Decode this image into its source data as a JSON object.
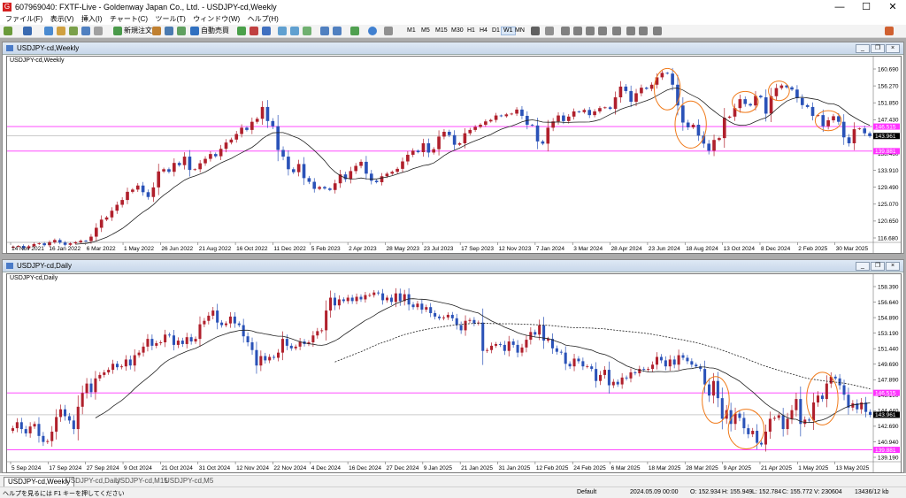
{
  "window": {
    "title": "607969040: FXTF-Live - Goldenway Japan Co., Ltd. - USDJPY-cd,Weekly",
    "minimize": "—",
    "maximize": "☐",
    "close": "✕"
  },
  "menu": [
    "ファイル(F)",
    "表示(V)",
    "挿入(I)",
    "チャート(C)",
    "ツール(T)",
    "ウィンドウ(W)",
    "ヘルプ(H)"
  ],
  "toolbar": {
    "new_order": "新規注文",
    "auto_trading": "自動売買",
    "timeframes": [
      "M1",
      "M5",
      "M15",
      "M30",
      "H1",
      "H4",
      "D1",
      "W1",
      "MN"
    ],
    "active_timeframe": "W1"
  },
  "weekly": {
    "caption": "USDJPY-cd,Weekly",
    "symbol_label": "USDJPY-cd,Weekly",
    "price_labels": [
      "160.690",
      "156.270",
      "151.850",
      "147.430",
      "143.010",
      "138.460",
      "133.910",
      "129.490",
      "125.070",
      "120.650",
      "116.680"
    ],
    "current_price": "143.961",
    "line_high_label": "146.515",
    "line_low_label": "139.881",
    "date_labels": [
      "14 Nov 2021",
      "16 Jan 2022",
      "6 Mar 2022",
      "1 May 2022",
      "26 Jun 2022",
      "21 Aug 2022",
      "16 Oct 2022",
      "11 Dec 2022",
      "5 Feb 2023",
      "2 Apr 2023",
      "28 May 2023",
      "23 Jul 2023",
      "17 Sep 2023",
      "12 Nov 2023",
      "7 Jan 2024",
      "3 Mar 2024",
      "28 Apr 2024",
      "23 Jun 2024",
      "18 Aug 2024",
      "13 Oct 2024",
      "8 Dec 2024",
      "2 Feb 2025",
      "30 Mar 2025"
    ]
  },
  "daily": {
    "caption": "USDJPY-cd,Daily",
    "symbol_label": "USDJPY-cd,Daily",
    "price_labels": [
      "158.390",
      "156.640",
      "154.890",
      "153.190",
      "151.440",
      "149.690",
      "147.890",
      "146.190",
      "144.440",
      "142.690",
      "140.940",
      "139.190"
    ],
    "current_price": "143.961",
    "line_high_label": "146.515",
    "line_low_label": "139.881",
    "date_labels": [
      "5 Sep 2024",
      "17 Sep 2024",
      "27 Sep 2024",
      "9 Oct 2024",
      "21 Oct 2024",
      "31 Oct 2024",
      "12 Nov 2024",
      "22 Nov 2024",
      "4 Dec 2024",
      "16 Dec 2024",
      "27 Dec 2024",
      "9 Jan 2025",
      "21 Jan 2025",
      "31 Jan 2025",
      "12 Feb 2025",
      "24 Feb 2025",
      "6 Mar 2025",
      "18 Mar 2025",
      "28 Mar 2025",
      "9 Apr 2025",
      "21 Apr 2025",
      "1 May 2025",
      "13 May 2025"
    ]
  },
  "tabs": [
    "USDJPY-cd,Weekly",
    "USDJPY-cd,Daily",
    "USDJPY-cd,M15",
    "USDJPY-cd,M5"
  ],
  "status": {
    "help": "ヘルプを見るには F1 キーを押してください",
    "profile": "Default",
    "datetime": "2024.05.09 00:00",
    "open": "O: 152.934",
    "high": "H: 155.949",
    "low": "L: 152.784",
    "close": "C: 155.772",
    "volume": "V: 230604",
    "traffic": "13436/12 kb"
  },
  "colors": {
    "bull": "#b0202c",
    "bear": "#2a52b8",
    "ma": "#222222",
    "hline": "#ff33ff",
    "annotation": "#f07a1a"
  },
  "chart_data": [
    {
      "type": "candlestick",
      "title": "USDJPY-cd,Weekly",
      "ylim": [
        115.5,
        163.0
      ],
      "level_lines": [
        146.515,
        139.881
      ],
      "current": 143.961,
      "closes": [
        114.1,
        114.3,
        113.7,
        114.2,
        114.8,
        115.0,
        114.5,
        115.3,
        115.9,
        115.2,
        114.6,
        115.0,
        115.3,
        115.7,
        115.6,
        116.8,
        119.2,
        121.4,
        122.0,
        123.8,
        125.4,
        126.7,
        128.9,
        129.5,
        130.6,
        128.8,
        127.5,
        130.1,
        134.4,
        135.0,
        134.3,
        136.7,
        136.1,
        138.4,
        134.8,
        135.0,
        136.6,
        137.8,
        139.1,
        138.5,
        140.5,
        142.2,
        143.0,
        144.5,
        146.2,
        145.6,
        147.8,
        148.6,
        151.8,
        148.0,
        146.6,
        140.2,
        138.4,
        135.0,
        134.2,
        136.4,
        132.6,
        131.6,
        129.7,
        130.2,
        129.8,
        129.4,
        131.2,
        133.6,
        132.3,
        134.5,
        135.9,
        137.0,
        133.8,
        131.9,
        131.5,
        133.1,
        133.8,
        134.3,
        135.1,
        137.1,
        138.9,
        140.0,
        139.6,
        142.0,
        139.5,
        140.4,
        143.8,
        145.1,
        144.2,
        141.6,
        142.0,
        144.7,
        145.6,
        146.4,
        147.0,
        147.9,
        148.3,
        149.5,
        149.3,
        149.8,
        150.0,
        151.1,
        149.4,
        147.0,
        146.8,
        142.5,
        141.9,
        146.2,
        147.9,
        149.5,
        148.0,
        149.2,
        150.6,
        150.4,
        151.0,
        149.6,
        150.6,
        151.5,
        151.7,
        151.3,
        154.4,
        157.3,
        156.1,
        153.2,
        155.5,
        157.0,
        156.7,
        157.8,
        159.8,
        161.0,
        160.8,
        157.8,
        152.2,
        147.6,
        146.3,
        147.0,
        144.1,
        141.9,
        140.0,
        142.9,
        143.4,
        148.9,
        149.2,
        151.5,
        153.9,
        152.6,
        152.2,
        154.8,
        154.4,
        150.0,
        154.7,
        156.9,
        157.6,
        157.1,
        156.5,
        154.2,
        152.3,
        151.8,
        149.4,
        149.6,
        146.6,
        148.2,
        149.3,
        147.8,
        143.6,
        142.0,
        145.8,
        146.0,
        144.7,
        143.961
      ],
      "ma_period": 13
    },
    {
      "type": "candlestick",
      "title": "USDJPY-cd,Daily",
      "ylim": [
        138.6,
        159.3
      ],
      "level_lines": [
        146.515,
        139.881
      ],
      "current": 143.961,
      "closes": [
        142.4,
        143.1,
        142.3,
        141.8,
        142.6,
        142.9,
        141.5,
        140.8,
        140.9,
        142.0,
        143.7,
        144.6,
        143.8,
        143.3,
        142.3,
        144.9,
        146.5,
        147.6,
        146.6,
        148.2,
        148.6,
        148.9,
        149.2,
        149.9,
        149.5,
        149.6,
        150.4,
        149.7,
        150.9,
        151.2,
        151.9,
        152.8,
        152.0,
        152.3,
        152.4,
        153.3,
        153.2,
        152.1,
        152.6,
        152.2,
        153.0,
        152.5,
        152.8,
        154.5,
        154.9,
        155.5,
        156.1,
        154.7,
        154.4,
        154.6,
        155.4,
        154.6,
        154.4,
        153.1,
        152.4,
        151.5,
        149.7,
        150.8,
        150.3,
        150.7,
        150.6,
        151.2,
        152.8,
        152.0,
        151.7,
        151.9,
        152.5,
        152.2,
        152.4,
        153.2,
        153.7,
        153.8,
        156.1,
        157.6,
        156.7,
        157.4,
        157.2,
        157.6,
        157.2,
        157.7,
        157.4,
        157.9,
        157.9,
        158.2,
        158.1,
        157.3,
        157.6,
        157.1,
        158.1,
        157.2,
        158.0,
        156.8,
        156.5,
        156.9,
        156.2,
        156.5,
        155.8,
        155.4,
        155.2,
        155.3,
        155.6,
        155.2,
        154.4,
        153.8,
        154.9,
        155.0,
        154.6,
        154.7,
        151.4,
        151.5,
        152.0,
        152.2,
        152.1,
        151.4,
        152.5,
        152.1,
        151.2,
        151.8,
        152.7,
        153.6,
        153.3,
        154.4,
        152.6,
        152.8,
        151.7,
        151.3,
        151.2,
        149.9,
        149.6,
        150.5,
        150.2,
        149.6,
        149.6,
        149.3,
        147.9,
        148.6,
        149.2,
        147.4,
        147.8,
        147.5,
        148.3,
        148.2,
        148.9,
        148.8,
        149.3,
        149.2,
        149.3,
        149.8,
        150.7,
        150.3,
        149.6,
        150.4,
        149.8,
        150.9,
        150.6,
        150.2,
        149.8,
        149.6,
        149.3,
        147.5,
        146.2,
        147.9,
        145.9,
        143.5,
        144.5,
        142.9,
        144.1,
        143.6,
        142.4,
        141.7,
        142.1,
        140.7,
        140.5,
        142.0,
        143.5,
        143.6,
        143.9,
        142.3,
        143.5,
        144.5,
        145.8,
        142.9,
        143.4,
        143.3,
        145.4,
        146.2,
        145.8,
        147.6,
        148.4,
        148.2,
        147.4,
        146.3,
        144.8,
        145.3,
        144.6,
        145.4,
        144.3,
        143.961
      ],
      "ma_period": 20,
      "ma2_period": 75
    }
  ]
}
